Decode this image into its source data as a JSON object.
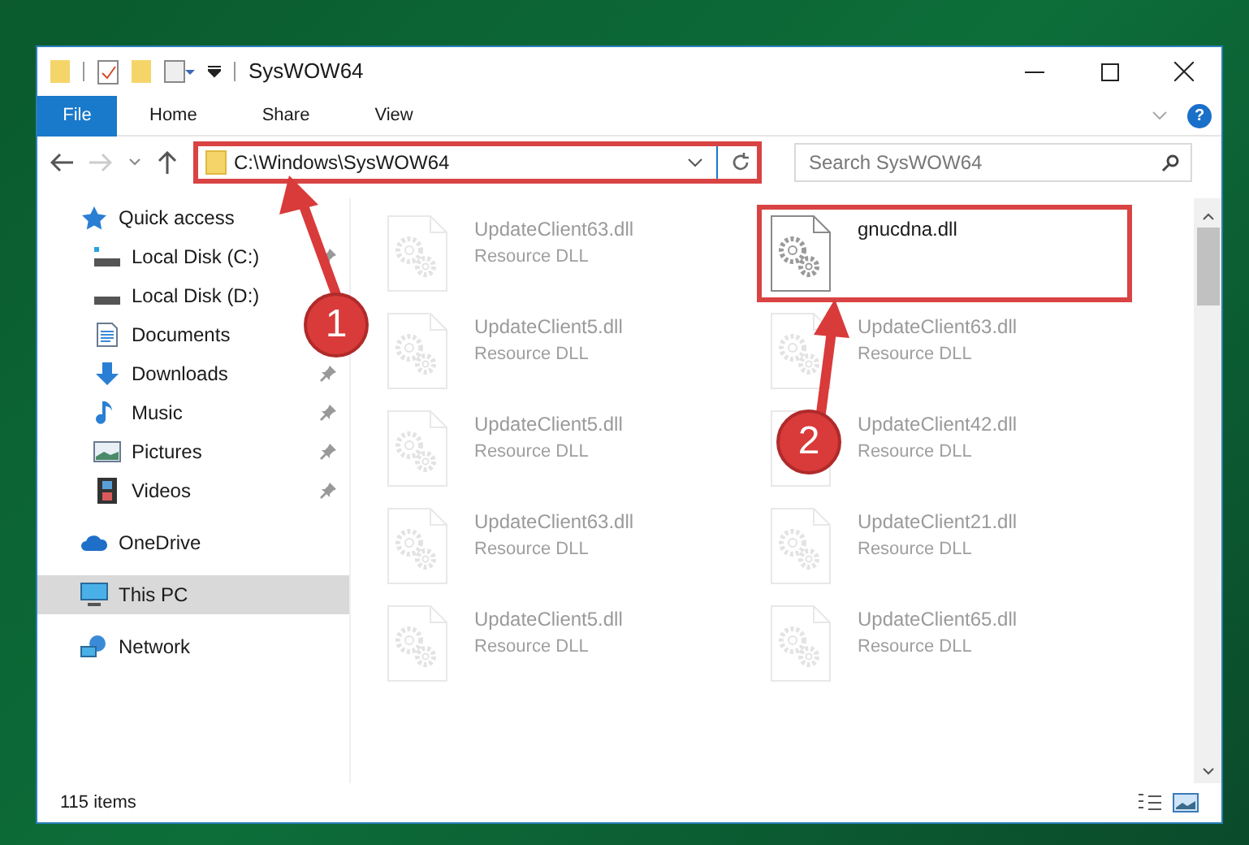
{
  "window": {
    "title": "SysWOW64"
  },
  "ribbon_tabs": [
    {
      "label": "File",
      "selected": true
    },
    {
      "label": "Home",
      "selected": false
    },
    {
      "label": "Share",
      "selected": false
    },
    {
      "label": "View",
      "selected": false
    }
  ],
  "address_bar": {
    "path": "C:\\Windows\\SysWOW64",
    "highlighted": true
  },
  "search": {
    "placeholder": "Search SysWOW64"
  },
  "help": {
    "label": "?"
  },
  "sidebar": {
    "items": [
      {
        "label": "Quick access",
        "kind": "star",
        "selected": false,
        "children": [
          {
            "label": "Local Disk (C:)",
            "kind": "drive-c",
            "pinned": true,
            "selected": false
          },
          {
            "label": "Local Disk (D:)",
            "kind": "drive",
            "pinned": false,
            "selected": false
          },
          {
            "label": "Documents",
            "kind": "docs",
            "pinned": false,
            "selected": false
          },
          {
            "label": "Downloads",
            "kind": "download",
            "pinned": true,
            "selected": false
          },
          {
            "label": "Music",
            "kind": "music",
            "pinned": true,
            "selected": false
          },
          {
            "label": "Pictures",
            "kind": "pictures",
            "pinned": true,
            "selected": false
          },
          {
            "label": "Videos",
            "kind": "videos",
            "pinned": true,
            "selected": false
          }
        ]
      },
      {
        "label": "OneDrive",
        "kind": "cloud",
        "selected": false
      },
      {
        "label": "This PC",
        "kind": "pc",
        "selected": true
      },
      {
        "label": "Network",
        "kind": "network",
        "selected": false
      }
    ]
  },
  "files": [
    {
      "name": "UpdateClient63.dll",
      "type": "Resource DLL",
      "highlighted": false
    },
    {
      "name": "gnucdna.dll",
      "highlighted": true
    },
    {
      "name": "UpdateClient5.dll",
      "type": "Resource DLL",
      "highlighted": false
    },
    {
      "name": "UpdateClient63.dll",
      "type": "Resource DLL",
      "highlighted": false
    },
    {
      "name": "UpdateClient5.dll",
      "type": "Resource DLL",
      "highlighted": false
    },
    {
      "name": "UpdateClient42.dll",
      "type": "Resource DLL",
      "highlighted": false
    },
    {
      "name": "UpdateClient63.dll",
      "type": "Resource DLL",
      "highlighted": false
    },
    {
      "name": "UpdateClient21.dll",
      "type": "Resource DLL",
      "highlighted": false
    },
    {
      "name": "UpdateClient5.dll",
      "type": "Resource DLL",
      "highlighted": false
    },
    {
      "name": "UpdateClient65.dll",
      "type": "Resource DLL",
      "highlighted": false
    }
  ],
  "status_bar": {
    "item_count": "115 items"
  },
  "annotations": [
    {
      "number": "1"
    },
    {
      "number": "2"
    }
  ]
}
